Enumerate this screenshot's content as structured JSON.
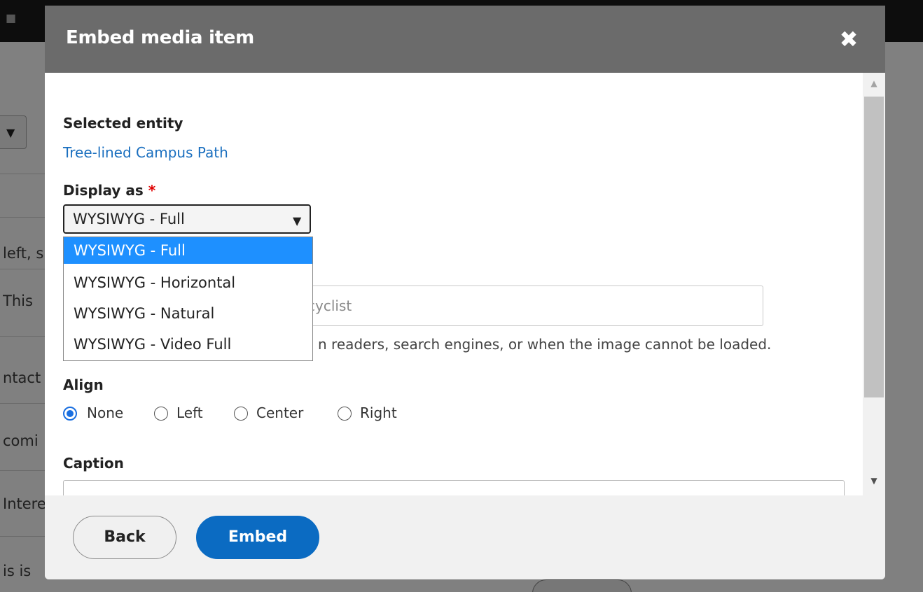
{
  "dialog": {
    "title": "Embed media item",
    "close_icon": "close-icon"
  },
  "form": {
    "selected_entity_label": "Selected entity",
    "selected_entity_link": "Tree-lined Campus Path",
    "display_as_label": "Display as",
    "required_marker": "*",
    "display_as_value": "WYSIWYG - Full",
    "display_as_options": [
      "WYSIWYG - Full",
      "WYSIWYG - Horizontal",
      "WYSIWYG - Natural",
      "WYSIWYG - Video Full"
    ],
    "alt_value_visible": "cyclist",
    "alt_description_visible": "n readers, search engines, or when the image cannot be loaded.",
    "align_label": "Align",
    "align_options": [
      "None",
      "Left",
      "Center",
      "Right"
    ],
    "align_selected": "None",
    "caption_label": "Caption",
    "caption_value": ""
  },
  "footer": {
    "back_label": "Back",
    "embed_label": "Embed"
  },
  "background": {
    "row_fragments": [
      "left, s",
      "This",
      "ntact",
      "comi",
      "Intere",
      "is is"
    ]
  },
  "colors": {
    "header_bg": "#6b6b6b",
    "link": "#1a6fbf",
    "primary_button": "#0b6bc2",
    "selected_option": "#1e90ff",
    "radio_checked": "#1a6fe0",
    "required": "#e00000"
  }
}
